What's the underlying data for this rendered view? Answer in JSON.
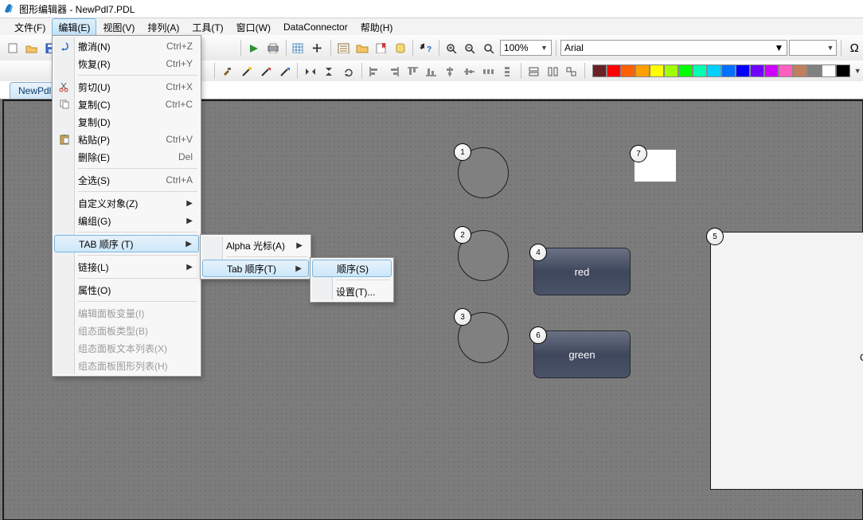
{
  "window": {
    "app_title": "图形编辑器",
    "doc_title": "NewPdl7.PDL",
    "title_text": "图形编辑器 - NewPdl7.PDL"
  },
  "menubar": {
    "items": [
      {
        "label": "文件(F)"
      },
      {
        "label": "编辑(E)"
      },
      {
        "label": "视图(V)"
      },
      {
        "label": "排列(A)"
      },
      {
        "label": "工具(T)"
      },
      {
        "label": "窗口(W)"
      },
      {
        "label": "DataConnector"
      },
      {
        "label": "帮助(H)"
      }
    ]
  },
  "edit_menu": {
    "items": [
      {
        "label": "撤消(N)",
        "accel": "Ctrl+Z",
        "icon": "undo"
      },
      {
        "label": "恢复(R)",
        "accel": "Ctrl+Y"
      },
      {
        "sep": true
      },
      {
        "label": "剪切(U)",
        "accel": "Ctrl+X",
        "icon": "cut"
      },
      {
        "label": "复制(C)",
        "accel": "Ctrl+C",
        "icon": "copy"
      },
      {
        "label": "复制(D)"
      },
      {
        "label": "粘贴(P)",
        "accel": "Ctrl+V",
        "icon": "paste"
      },
      {
        "label": "删除(E)",
        "accel": "Del"
      },
      {
        "sep": true
      },
      {
        "label": "全选(S)",
        "accel": "Ctrl+A"
      },
      {
        "sep": true
      },
      {
        "label": "自定义对象(Z)",
        "submenu": true
      },
      {
        "label": "编组(G)",
        "submenu": true
      },
      {
        "sep": true
      },
      {
        "label": "TAB 顺序 (T)",
        "submenu": true,
        "highlight": true
      },
      {
        "sep": true
      },
      {
        "label": "链接(L)",
        "submenu": true
      },
      {
        "sep": true
      },
      {
        "label": "属性(O)"
      },
      {
        "sep": true
      },
      {
        "label": "编辑面板变量(I)",
        "disabled": true
      },
      {
        "label": "组态面板类型(B)",
        "disabled": true
      },
      {
        "label": "组态面板文本列表(X)",
        "disabled": true
      },
      {
        "label": "组态面板图形列表(H)",
        "disabled": true
      }
    ]
  },
  "tab_order_submenu": {
    "items": [
      {
        "label": "Alpha 光标(A)",
        "submenu": true
      },
      {
        "label": "Tab 顺序(T)",
        "submenu": true,
        "highlight": true
      }
    ]
  },
  "tab_order_leaf_menu": {
    "items": [
      {
        "label": "顺序(S)",
        "highlight": true
      },
      {
        "label": "设置(T)..."
      }
    ]
  },
  "toolbar": {
    "zoom_value": "100%",
    "font_name": "Arial",
    "omega": "Ω"
  },
  "color_palette": [
    "#6a2226",
    "#ff0000",
    "#ff8000",
    "#ff8000",
    "#ffff00",
    "#80ff00",
    "#00ff00",
    "#00ffd0",
    "#00b0ff",
    "#0060ff",
    "#0000ff",
    "#8000ff",
    "#ff00ff",
    "#ff80c0",
    "#c08060",
    "#808080",
    "#ffffff",
    "#000000"
  ],
  "doc_tab": "NewPdl7",
  "canvas": {
    "circle1": {
      "num": "1"
    },
    "circle2": {
      "num": "2"
    },
    "circle3": {
      "num": "3"
    },
    "btn_red": {
      "num": "4",
      "label": "red"
    },
    "btn_green": {
      "num": "6",
      "label": "green"
    },
    "rect_big": {
      "num": "5",
      "label": "GSC"
    },
    "box_white": {
      "num": "7"
    }
  }
}
